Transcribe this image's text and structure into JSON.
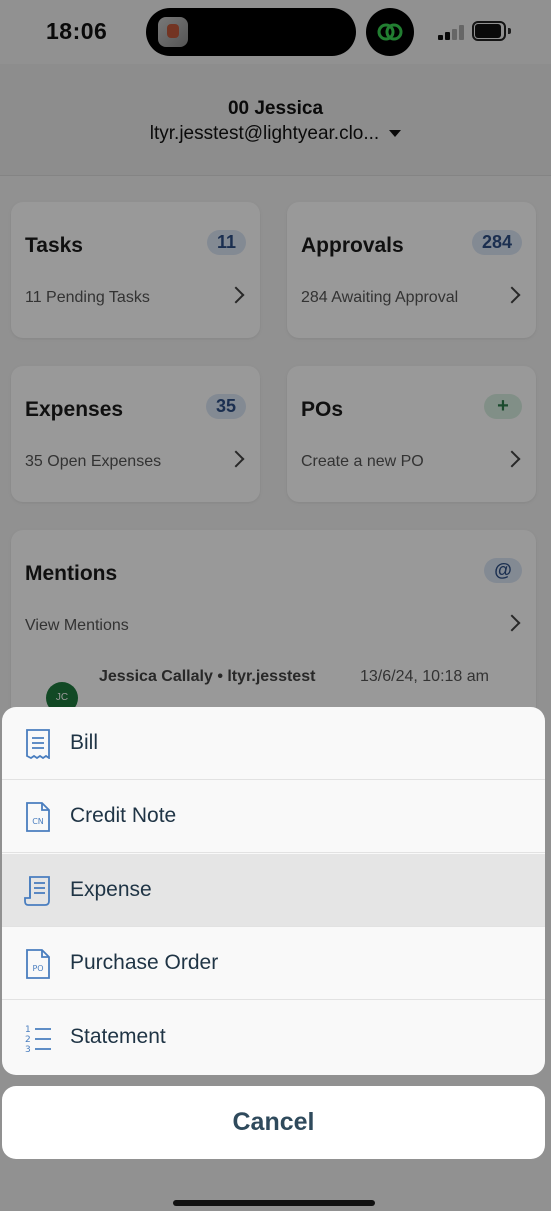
{
  "status_bar": {
    "time": "18:06"
  },
  "header": {
    "user_name": "00 Jessica",
    "user_email": "ltyr.jesstest@lightyear.clo..."
  },
  "cards": {
    "tasks": {
      "title": "Tasks",
      "badge": "11",
      "subtitle": "11 Pending Tasks"
    },
    "approvals": {
      "title": "Approvals",
      "badge": "284",
      "subtitle": "284 Awaiting Approval"
    },
    "expenses": {
      "title": "Expenses",
      "badge": "35",
      "subtitle": "35 Open Expenses"
    },
    "pos": {
      "title": "POs",
      "badge": "+",
      "subtitle": "Create a new PO"
    }
  },
  "mentions": {
    "title": "Mentions",
    "badge": "@",
    "subtitle": "View Mentions",
    "item": {
      "author": "Jessica Callaly • ltyr.jesstest",
      "date": "13/6/24, 10:18 am",
      "avatar_initials": "JC"
    }
  },
  "action_sheet": {
    "items": [
      {
        "label": "Bill",
        "icon": "bill-icon"
      },
      {
        "label": "Credit Note",
        "icon": "credit-note-icon"
      },
      {
        "label": "Expense",
        "icon": "expense-icon",
        "selected": true
      },
      {
        "label": "Purchase Order",
        "icon": "purchase-order-icon"
      },
      {
        "label": "Statement",
        "icon": "statement-icon"
      }
    ],
    "cancel_label": "Cancel"
  },
  "colors": {
    "accent_blue": "#4a7ebf",
    "badge_blue_bg": "#dbe6f6",
    "badge_green_bg": "#d8efe1",
    "brand_green": "#39d353"
  }
}
